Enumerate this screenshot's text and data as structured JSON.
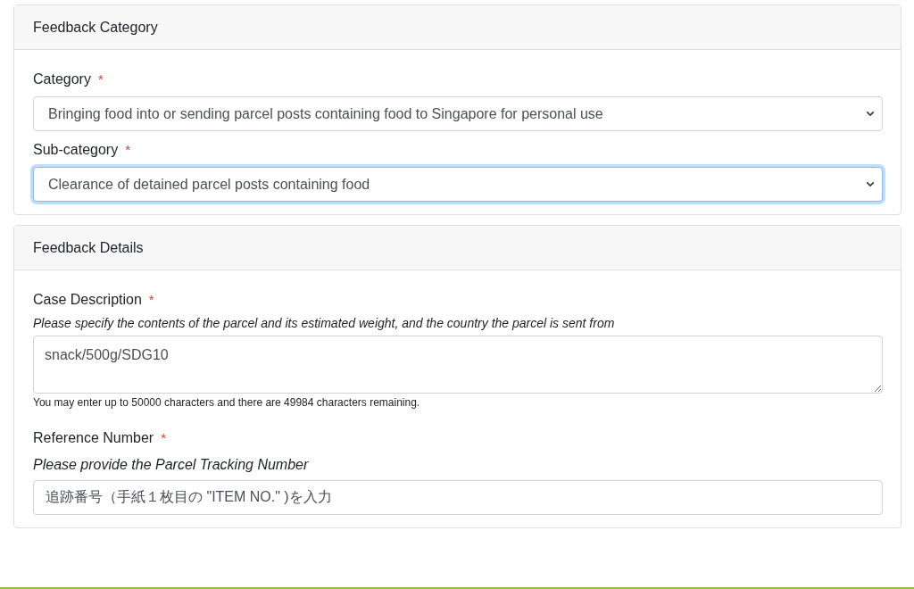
{
  "cards": [
    {
      "title": "Feedback Category",
      "fields": [
        {
          "kind": "select",
          "label": "Category",
          "required_mark": "*",
          "value": "Bringing food into or sending parcel posts containing food to Singapore for personal use",
          "focused": false
        },
        {
          "kind": "select",
          "label": "Sub-category",
          "required_mark": "*",
          "value": "Clearance of detained parcel posts containing food",
          "focused": true
        }
      ]
    },
    {
      "title": "Feedback Details",
      "fields": [
        {
          "kind": "textarea",
          "label": "Case Description",
          "required_mark": "*",
          "hint": "Please specify the contents of the parcel and its estimated weight, and the country the parcel is sent from",
          "value": "snack/500g/SDG10",
          "focused": false,
          "counter": "You may enter up to 50000 characters and there are 49984 characters remaining."
        },
        {
          "kind": "text",
          "label": "Reference Number",
          "required_mark": "*",
          "hint": "Please provide the Parcel Tracking Number",
          "value": "追跡番号（手紙１枚目の \"ITEM NO.\" )を入力",
          "focused": false
        }
      ]
    }
  ]
}
